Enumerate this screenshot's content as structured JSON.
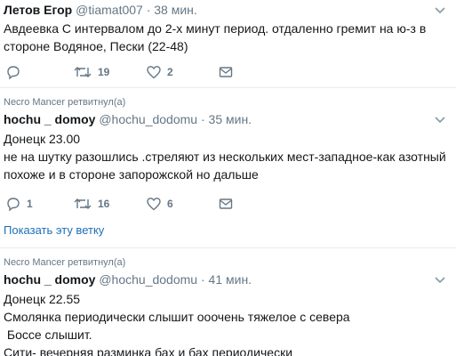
{
  "tweets": [
    {
      "name": "Летов Егор",
      "handle": "@tiamat007",
      "time": "· 38 мин.",
      "lines": [
        "Авдеевка С интервалом до 2-х минут период. отдаленно гремит на ю-з в",
        "стороне Водяное, Пески (22-48)"
      ],
      "replies": "",
      "retweets": "19",
      "likes": "2"
    },
    {
      "retweeted_by": "Necro Mancer ретвитнул(а)",
      "name": "hochu _ domoy",
      "handle": "@hochu_dodomu",
      "time": "· 35 мин.",
      "lines": [
        "Донецк 23.00",
        "не на шутку разошлись .стреляют из нескольких мест-западное-как азотный",
        "похоже и в стороне запорожской но дальше"
      ],
      "replies": "1",
      "retweets": "16",
      "likes": "6",
      "show_thread": "Показать эту ветку"
    },
    {
      "retweeted_by": "Necro Mancer ретвитнул(а)",
      "name": "hochu _ domoy",
      "handle": "@hochu_dodomu",
      "time": "· 41 мин.",
      "lines": [
        "Донецк 22.55",
        "Смолянка периодически слышит ооочень тяжелое с севера",
        " Боссе слышит.",
        "Сити- вечерняя разминка бах и бах периодически"
      ]
    }
  ],
  "colors": {
    "text": "#14171a",
    "muted": "#657786",
    "link": "#1d6fb8",
    "divider": "#e6ecf0"
  },
  "icons": [
    "reply-icon",
    "retweet-icon",
    "like-icon",
    "message-icon",
    "chevron-down-icon"
  ]
}
